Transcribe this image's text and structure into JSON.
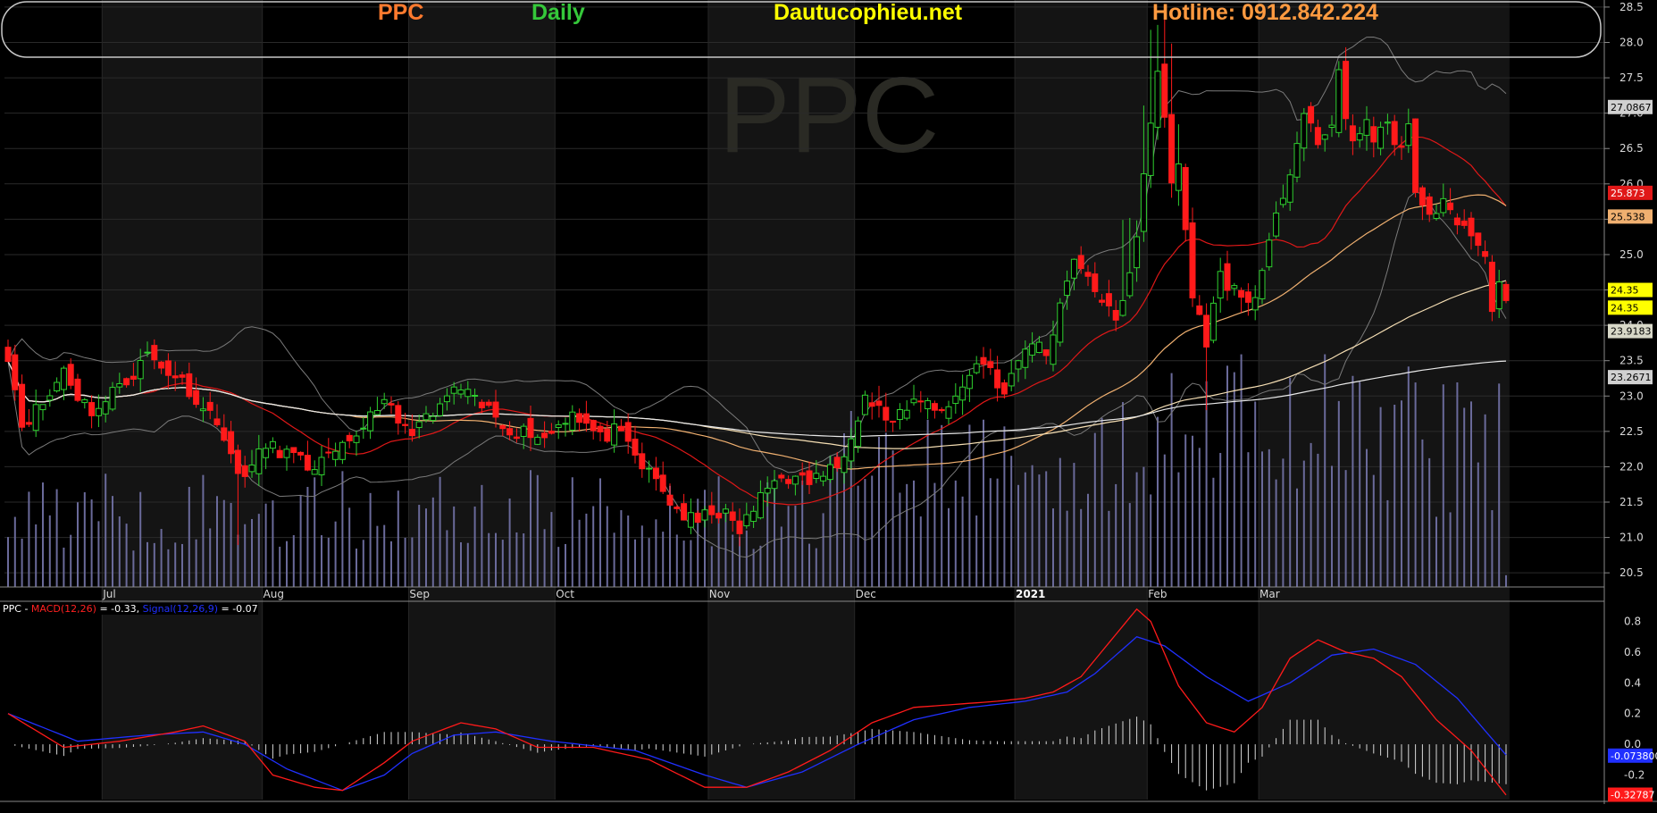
{
  "header": {
    "symbol": "PPC",
    "interval": "Daily",
    "site": "Dautucophieu.net",
    "hotline": "Hotline: 0912.842.224",
    "colors": {
      "symbol": "#ff7a2e",
      "interval": "#35c83a",
      "site": "#ffff00",
      "hotline": "#ff9a40"
    }
  },
  "watermark": "PPC",
  "macd_legend": {
    "symbol": "PPC",
    "sep": " - ",
    "macd_label": "MACD(12,26)",
    "macd_value": " = -0.33, ",
    "signal_label": "Signal(12,26,9)",
    "signal_value": " = -0.07"
  },
  "price_badges": {
    "bb_upper": "27.0867",
    "ma20": "25.873",
    "ma50": "25.538",
    "close": "24.35",
    "close2": "24.35",
    "ma100": "23.9183",
    "ma200": "23.2671",
    "signal": "-0.073800",
    "macd": "-0.32787"
  },
  "chart_data": [
    {
      "type": "candlestick",
      "y_ticks": [
        "28.5",
        "28.0",
        "27.5",
        "27.0",
        "26.5",
        "26.0",
        "25.5",
        "25.0",
        "24.5",
        "24.0",
        "23.5",
        "23.0",
        "22.5",
        "22.0",
        "21.5",
        "21.0",
        "20.5"
      ],
      "ylim": [
        20.3,
        28.6
      ],
      "x_labels": [
        {
          "label": "Jul",
          "index": 14
        },
        {
          "label": "Aug",
          "index": 37
        },
        {
          "label": "Sep",
          "index": 58
        },
        {
          "label": "Oct",
          "index": 79
        },
        {
          "label": "Nov",
          "index": 101
        },
        {
          "label": "Dec",
          "index": 122
        },
        {
          "label": "2021",
          "index": 145
        },
        {
          "label": "Feb",
          "index": 164
        },
        {
          "label": "Mar",
          "index": 180
        }
      ],
      "close_key": [
        [
          0,
          23.6
        ],
        [
          2,
          22.6
        ],
        [
          4,
          22.8
        ],
        [
          6,
          23.0
        ],
        [
          8,
          23.4
        ],
        [
          10,
          23.0
        ],
        [
          12,
          22.8
        ],
        [
          14,
          22.9
        ],
        [
          16,
          23.2
        ],
        [
          18,
          23.3
        ],
        [
          20,
          23.6
        ],
        [
          22,
          23.4
        ],
        [
          24,
          23.3
        ],
        [
          26,
          23.1
        ],
        [
          28,
          22.8
        ],
        [
          30,
          22.7
        ],
        [
          32,
          22.1
        ],
        [
          33,
          21.9
        ],
        [
          35,
          22.0
        ],
        [
          37,
          22.3
        ],
        [
          40,
          22.2
        ],
        [
          43,
          22.0
        ],
        [
          46,
          22.1
        ],
        [
          49,
          22.3
        ],
        [
          51,
          22.6
        ],
        [
          53,
          22.9
        ],
        [
          55,
          22.8
        ],
        [
          57,
          22.5
        ],
        [
          59,
          22.6
        ],
        [
          61,
          22.7
        ],
        [
          63,
          23.0
        ],
        [
          65,
          23.1
        ],
        [
          67,
          22.9
        ],
        [
          69,
          22.8
        ],
        [
          71,
          22.6
        ],
        [
          73,
          22.5
        ],
        [
          75,
          22.5
        ],
        [
          77,
          22.4
        ],
        [
          79,
          22.6
        ],
        [
          81,
          22.8
        ],
        [
          83,
          22.6
        ],
        [
          85,
          22.4
        ],
        [
          87,
          22.5
        ],
        [
          89,
          22.3
        ],
        [
          91,
          22.0
        ],
        [
          93,
          21.8
        ],
        [
          95,
          21.5
        ],
        [
          97,
          21.3
        ],
        [
          99,
          21.2
        ],
        [
          101,
          21.4
        ],
        [
          103,
          21.3
        ],
        [
          105,
          21.1
        ],
        [
          107,
          21.4
        ],
        [
          109,
          21.7
        ],
        [
          111,
          21.9
        ],
        [
          113,
          21.8
        ],
        [
          115,
          21.8
        ],
        [
          117,
          21.9
        ],
        [
          119,
          22.0
        ],
        [
          121,
          22.5
        ],
        [
          123,
          23.0
        ],
        [
          125,
          22.8
        ],
        [
          127,
          22.6
        ],
        [
          129,
          22.8
        ],
        [
          131,
          23.0
        ],
        [
          133,
          22.8
        ],
        [
          135,
          22.9
        ],
        [
          137,
          23.1
        ],
        [
          139,
          23.5
        ],
        [
          141,
          23.4
        ],
        [
          143,
          23.0
        ],
        [
          145,
          23.5
        ],
        [
          147,
          23.8
        ],
        [
          149,
          23.6
        ],
        [
          151,
          24.3
        ],
        [
          153,
          25.0
        ],
        [
          155,
          24.6
        ],
        [
          157,
          24.4
        ],
        [
          159,
          24.0
        ],
        [
          160,
          24.3
        ],
        [
          162,
          25.3
        ],
        [
          163,
          26.2
        ],
        [
          164,
          26.9
        ],
        [
          165,
          27.5
        ],
        [
          166,
          26.9
        ],
        [
          167,
          26.0
        ],
        [
          168,
          26.3
        ],
        [
          170,
          24.4
        ],
        [
          172,
          23.8
        ],
        [
          174,
          24.7
        ],
        [
          176,
          24.5
        ],
        [
          178,
          24.3
        ],
        [
          180,
          24.7
        ],
        [
          182,
          25.5
        ],
        [
          184,
          26.2
        ],
        [
          186,
          27.0
        ],
        [
          188,
          26.5
        ],
        [
          190,
          26.9
        ],
        [
          191,
          27.6
        ],
        [
          192,
          26.9
        ],
        [
          193,
          26.5
        ],
        [
          195,
          27.0
        ],
        [
          196,
          26.6
        ],
        [
          198,
          26.8
        ],
        [
          200,
          26.5
        ],
        [
          201,
          26.8
        ],
        [
          202,
          25.8
        ],
        [
          204,
          25.6
        ],
        [
          206,
          25.7
        ],
        [
          208,
          25.5
        ],
        [
          210,
          25.3
        ],
        [
          212,
          24.9
        ],
        [
          213,
          24.3
        ],
        [
          214,
          24.6
        ],
        [
          215,
          24.35
        ]
      ],
      "volume_max": 0.4
    },
    {
      "type": "line",
      "title": "MACD(12,26)",
      "y_ticks": [
        "0.8",
        "0.6",
        "0.4",
        "0.2",
        "0.0",
        "-0.2"
      ],
      "ylim": [
        -0.36,
        0.96
      ],
      "macd_key": [
        [
          0,
          0.2
        ],
        [
          8,
          -0.02
        ],
        [
          16,
          0.02
        ],
        [
          24,
          0.08
        ],
        [
          28,
          0.12
        ],
        [
          34,
          0.02
        ],
        [
          38,
          -0.2
        ],
        [
          44,
          -0.28
        ],
        [
          48,
          -0.3
        ],
        [
          54,
          -0.12
        ],
        [
          58,
          0.02
        ],
        [
          65,
          0.14
        ],
        [
          70,
          0.1
        ],
        [
          76,
          -0.02
        ],
        [
          84,
          -0.02
        ],
        [
          92,
          -0.1
        ],
        [
          100,
          -0.28
        ],
        [
          106,
          -0.28
        ],
        [
          112,
          -0.18
        ],
        [
          118,
          -0.04
        ],
        [
          124,
          0.14
        ],
        [
          130,
          0.24
        ],
        [
          136,
          0.26
        ],
        [
          142,
          0.28
        ],
        [
          146,
          0.3
        ],
        [
          150,
          0.34
        ],
        [
          154,
          0.44
        ],
        [
          158,
          0.66
        ],
        [
          162,
          0.88
        ],
        [
          164,
          0.8
        ],
        [
          168,
          0.38
        ],
        [
          172,
          0.14
        ],
        [
          176,
          0.08
        ],
        [
          180,
          0.24
        ],
        [
          184,
          0.56
        ],
        [
          188,
          0.68
        ],
        [
          192,
          0.6
        ],
        [
          196,
          0.56
        ],
        [
          200,
          0.44
        ],
        [
          205,
          0.16
        ],
        [
          210,
          -0.04
        ],
        [
          215,
          -0.33
        ]
      ],
      "signal_key": [
        [
          0,
          0.2
        ],
        [
          10,
          0.02
        ],
        [
          20,
          0.06
        ],
        [
          28,
          0.08
        ],
        [
          34,
          0.0
        ],
        [
          40,
          -0.16
        ],
        [
          48,
          -0.3
        ],
        [
          54,
          -0.2
        ],
        [
          58,
          -0.06
        ],
        [
          64,
          0.06
        ],
        [
          70,
          0.08
        ],
        [
          78,
          0.02
        ],
        [
          90,
          -0.04
        ],
        [
          100,
          -0.2
        ],
        [
          106,
          -0.28
        ],
        [
          114,
          -0.18
        ],
        [
          122,
          0.0
        ],
        [
          130,
          0.16
        ],
        [
          138,
          0.24
        ],
        [
          146,
          0.28
        ],
        [
          152,
          0.34
        ],
        [
          156,
          0.46
        ],
        [
          162,
          0.7
        ],
        [
          166,
          0.64
        ],
        [
          172,
          0.44
        ],
        [
          178,
          0.28
        ],
        [
          184,
          0.4
        ],
        [
          190,
          0.58
        ],
        [
          196,
          0.62
        ],
        [
          202,
          0.52
        ],
        [
          208,
          0.3
        ],
        [
          215,
          -0.07
        ]
      ]
    }
  ]
}
